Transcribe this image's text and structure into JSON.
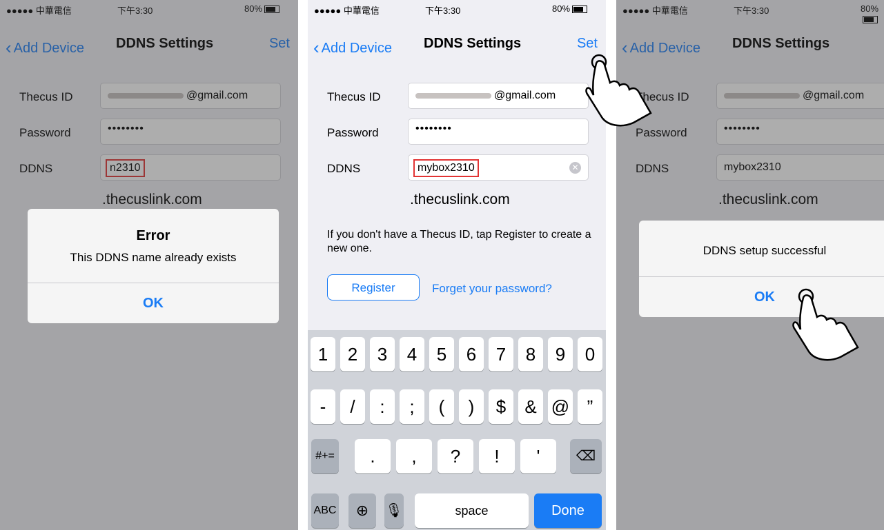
{
  "status_bar": {
    "carrier": "●●●●● 中華電信",
    "time": "下午3:30",
    "battery": "80%"
  },
  "nav": {
    "back_label": "Add Device",
    "title": "DDNS Settings",
    "set_label": "Set"
  },
  "form": {
    "thecus_id_label": "Thecus ID",
    "thecus_id_suffix": "@gmail.com",
    "password_label": "Password",
    "password_value": "••••••••",
    "ddns_label": "DDNS",
    "ddns_value_full": "mybox2310",
    "ddns_value_cut": "n2310",
    "domain_suffix": ".thecuslink.com"
  },
  "info_text": "If you don't have a Thecus ID, tap Register to create a new one.",
  "register_label": "Register",
  "forgot_label": "Forget your password?",
  "error_alert": {
    "title": "Error",
    "message": "This DDNS name already exists",
    "ok": "OK"
  },
  "success_alert": {
    "message": "DDNS setup successful",
    "ok": "OK"
  },
  "keyboard": {
    "row1": [
      "1",
      "2",
      "3",
      "4",
      "5",
      "6",
      "7",
      "8",
      "9",
      "0"
    ],
    "row2": [
      "-",
      "/",
      ":",
      ";",
      "(",
      ")",
      "$",
      "&",
      "@",
      "”"
    ],
    "row3": [
      "#+=",
      ".",
      ",",
      "?",
      "!",
      "'"
    ],
    "abc": "ABC",
    "space": "space",
    "done": "Done"
  },
  "colors": {
    "accent": "#1a7cf5",
    "highlight": "#e23333",
    "background": "#efeff4"
  }
}
